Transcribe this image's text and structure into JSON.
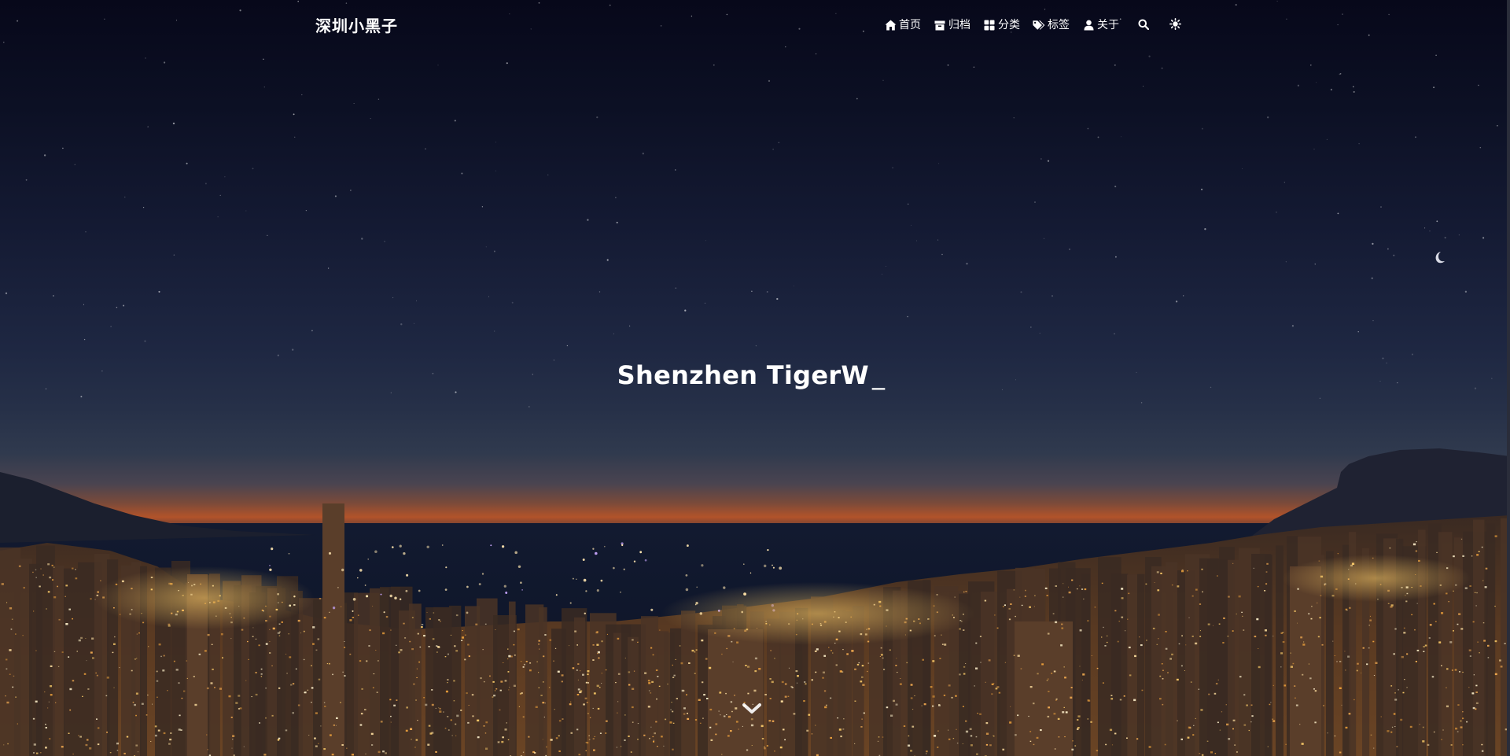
{
  "site": {
    "logo": "深圳小黑子"
  },
  "nav": {
    "items": [
      {
        "label": "首页",
        "icon": "home-icon"
      },
      {
        "label": "归档",
        "icon": "archive-icon"
      },
      {
        "label": "分类",
        "icon": "category-icon"
      },
      {
        "label": "标签",
        "icon": "tags-icon"
      },
      {
        "label": "关于",
        "icon": "user-icon"
      }
    ],
    "search_icon": "search-icon",
    "theme_icon": "sun-icon"
  },
  "hero": {
    "title": "Shenzhen TigerW",
    "cursor": "_",
    "scroll_icon": "chevron-down-icon",
    "moon_icon": "crescent-moon-icon"
  },
  "colors": {
    "text": "#ffffff",
    "sky_top": "#07081a",
    "horizon_glow": "#b2532a",
    "city_lights": "#f0a33c"
  }
}
